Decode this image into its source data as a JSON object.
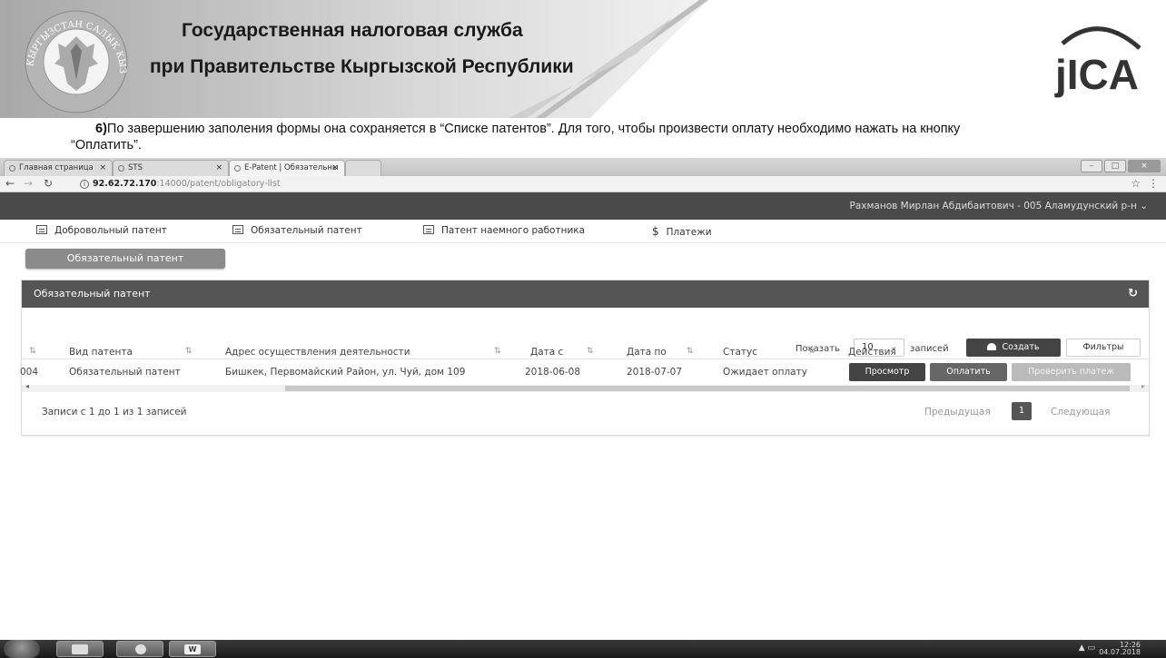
{
  "slide": {
    "org_line1": "Государственная налоговая служба",
    "org_line2": "при Правительстве Кыргызской Республики",
    "emblem_text": "КЫРГЫЗСТАН САЛЫК КЫЗМАТЫ",
    "logo_text": "jICA",
    "instruction_step": "6)",
    "instruction_line1": "По завершению заполения формы она сохраняется в “Списке патентов”. Для того, чтобы произвести оплату необходимо нажать на кнопку",
    "instruction_line2": "“Оплатить”."
  },
  "browser": {
    "tabs": [
      {
        "label": "Главная страница"
      },
      {
        "label": "STS"
      },
      {
        "label": "E-Patent | Обязательны"
      }
    ],
    "url_host": "92.62.72.170",
    "url_path": ":14000/patent/obligatory-list"
  },
  "app": {
    "user": "Рахманов Мирлан Абдибаитович - 005 Аламудунский р-н",
    "menu": [
      {
        "label": "Добровольный патент",
        "icon": "list-icon"
      },
      {
        "label": "Обязательный патент",
        "icon": "list-icon"
      },
      {
        "label": "Патент наемного работника",
        "icon": "list-icon"
      },
      {
        "label": "Платежи",
        "icon": "dollar-icon"
      }
    ],
    "page_button": "Обязательный патент",
    "panel_title": "Обязательный патент",
    "toolbar": {
      "show_label": "Показать",
      "page_length": "10",
      "records_label": "записей",
      "create_label": "Создать",
      "filters_label": "Фильтры"
    },
    "table": {
      "columns": [
        "Вид патента",
        "Адрес осуществления деятельности",
        "Дата с",
        "Дата по",
        "Статус",
        "Действия"
      ],
      "rows": [
        {
          "id_fragment": "004",
          "type": "Обязательный патент",
          "address": "Бишкек, Первомайский Район, ул. Чуй, дом 109",
          "date_from": "2018-06-08",
          "date_to": "2018-07-07",
          "status": "Ожидает оплату",
          "actions": [
            "Просмотр",
            "Оплатить",
            "Проверить платеж"
          ]
        }
      ]
    },
    "info": "Записи с 1 до 1 из 1 записей",
    "pagination": {
      "prev": "Предыдущая",
      "current": "1",
      "next": "Следующая"
    }
  },
  "taskbar": {
    "time": "12:26",
    "date": "04.07.2018"
  }
}
